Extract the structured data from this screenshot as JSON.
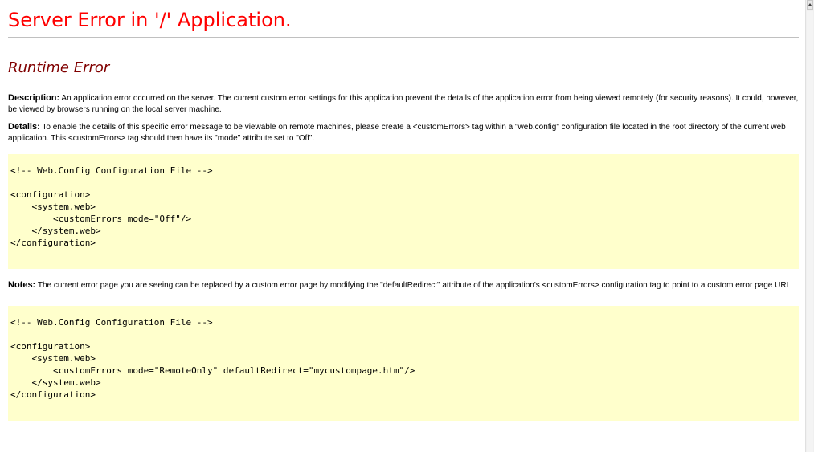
{
  "page_title": "Server Error in '/' Application.",
  "error_type": "Runtime Error",
  "description": {
    "label": "Description:",
    "text": " An application error occurred on the server. The current custom error settings for this application prevent the details of the application error from being viewed remotely (for security reasons). It could, however, be viewed by browsers running on the local server machine."
  },
  "details": {
    "label": "Details:",
    "text": " To enable the details of this specific error message to be viewable on remote machines, please create a <customErrors> tag within a \"web.config\" configuration file located in the root directory of the current web application. This <customErrors> tag should then have its \"mode\" attribute set to \"Off\"."
  },
  "code_sample_1": {
    "comment": "<!-- Web.Config Configuration File -->",
    "lines": [
      "<configuration>",
      "    <system.web>",
      "        <customErrors mode=\"Off\"/>",
      "    </system.web>",
      "</configuration>"
    ]
  },
  "notes": {
    "label": "Notes:",
    "text": " The current error page you are seeing can be replaced by a custom error page by modifying the \"defaultRedirect\" attribute of the application's <customErrors> configuration tag to point to a custom error page URL."
  },
  "code_sample_2": {
    "comment": "<!-- Web.Config Configuration File -->",
    "lines": [
      "<configuration>",
      "    <system.web>",
      "        <customErrors mode=\"RemoteOnly\" defaultRedirect=\"mycustompage.htm\"/>",
      "    </system.web>",
      "</configuration>"
    ]
  },
  "colors": {
    "title": "#ff0000",
    "subtitle": "#800000",
    "code_background": "#ffffcc"
  },
  "icons": {
    "scroll_up": "chevron-up-icon"
  }
}
